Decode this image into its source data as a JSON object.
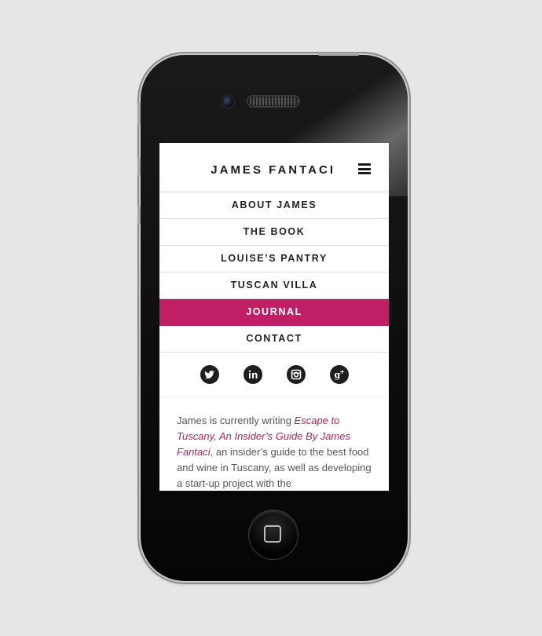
{
  "header": {
    "brand": "JAMES FANTACI",
    "menu_icon": "hamburger-icon"
  },
  "nav": {
    "items": [
      {
        "label": "ABOUT JAMES",
        "active": false
      },
      {
        "label": "THE BOOK",
        "active": false
      },
      {
        "label": "LOUISE’S PANTRY",
        "active": false
      },
      {
        "label": "TUSCAN VILLA",
        "active": false
      },
      {
        "label": "JOURNAL",
        "active": true
      },
      {
        "label": "CONTACT",
        "active": false
      }
    ]
  },
  "social": [
    "twitter-icon",
    "linkedin-icon",
    "instagram-icon",
    "google-plus-icon"
  ],
  "content": {
    "intro": "James is currently writing ",
    "book_title": "Escape to Tuscany, An Insider’s Guide By James Fantaci",
    "rest": ", an insider’s guide to the best food and wine in Tuscany, as well as developing a start-up project with the"
  },
  "colors": {
    "accent": "#c01f66",
    "link": "#b0235f",
    "text": "#555555"
  }
}
